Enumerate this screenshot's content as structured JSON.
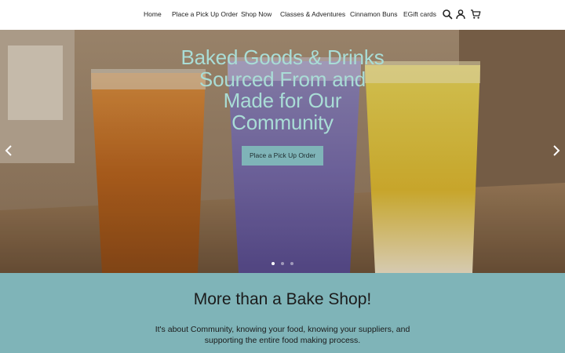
{
  "nav": {
    "items": [
      {
        "label": "Home"
      },
      {
        "label": "Place a Pick Up Order"
      },
      {
        "label": "Shop Now"
      },
      {
        "label": "Classes & Adventures"
      },
      {
        "label": "Cinnamon Buns"
      },
      {
        "label": "EGift cards"
      }
    ],
    "icons": [
      "search-icon",
      "account-icon",
      "cart-icon"
    ]
  },
  "hero": {
    "title_lines": [
      "Baked Goods & Drinks",
      "Sourced From and",
      "Made for Our",
      "Community"
    ],
    "button_label": "Place a Pick Up Order",
    "slide_count": 3,
    "active_slide": 1,
    "colors": {
      "title": "#a9ddd6",
      "button": "#7fb4b8"
    }
  },
  "about": {
    "title": "More than a Bake Shop!",
    "text": "It's about Community, knowing your food, knowing your suppliers, and supporting the entire food making process.",
    "background": "#7fb4b8"
  }
}
